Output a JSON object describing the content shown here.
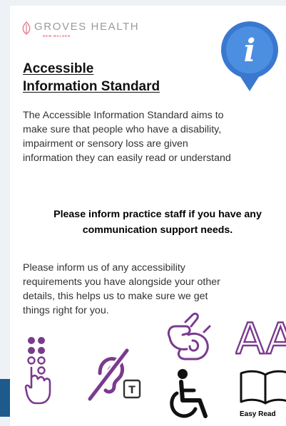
{
  "brand": {
    "name": "GROVES HEALTH",
    "sub": "NEW MALDEN"
  },
  "heading": {
    "line1": "Accessible",
    "line2": "Information Standard"
  },
  "intro": [
    "The Accessible Information Standard aims to",
    "make sure that people who have a disability,",
    "impairment or sensory loss are given",
    "information they can easily read or understand"
  ],
  "notice": {
    "line1": "Please inform practice staff if you have any",
    "line2": "communication support needs."
  },
  "request": [
    "Please inform us of any accessibility",
    "requirements you have alongside your other",
    "details, this helps us to make sure we get",
    "things right for you."
  ],
  "icons": {
    "info": "i",
    "text_size": "AA",
    "text_phone_key": "T",
    "easy_read": "Easy Read"
  },
  "colors": {
    "accent_purple": "#7a3a8e",
    "info_blue": "#3a78d0",
    "brand_pink": "#e27b8a",
    "brand_grey": "#9a9aa2"
  }
}
